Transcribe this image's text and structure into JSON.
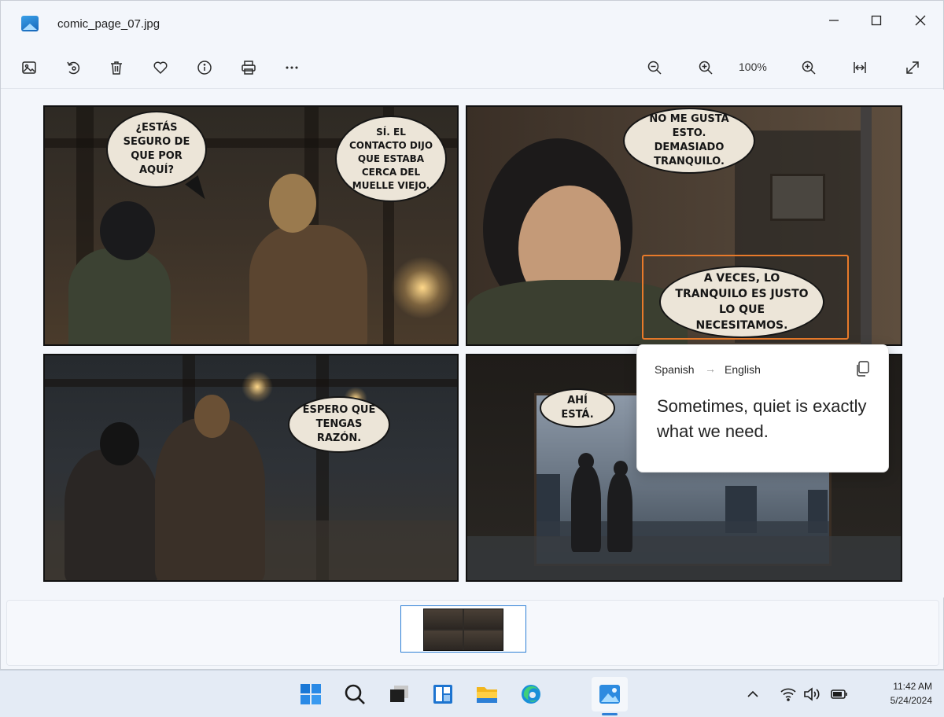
{
  "window": {
    "title": "comic_page_07.jpg"
  },
  "toolbar": {
    "zoom_level": "100%",
    "buttons": [
      "image-icon",
      "rotate-icon",
      "delete-icon",
      "heart-icon",
      "info-icon",
      "print-icon",
      "more-icon"
    ],
    "right_buttons": [
      "zoom-out-icon",
      "zoom-in-icon",
      "zoom-in-icon",
      "fit-width-icon",
      "fullscreen-icon"
    ]
  },
  "comic": {
    "panel1": {
      "bubble_left": "¿ESTÁS SEGURO DE QUE POR AQUÍ?",
      "bubble_right": "SÍ. EL CONTACTO DIJO QUE ESTABA CERCA DEL MUELLE VIEJO."
    },
    "panel2": {
      "bubble_top": "NO ME GUSTA ESTO. DEMASIADO TRANQUILO.",
      "bubble_highlighted": "A VECES, LO TRANQUILO ES JUSTO LO QUE NECESITAMOS."
    },
    "panel3": {
      "bubble": "ESPERO QUE TENGAS RAZÓN."
    },
    "panel4": {
      "bubble": "AHÍ ESTÁ."
    }
  },
  "translation_popup": {
    "source_language": "Spanish",
    "arrow": "→",
    "target_language": "English",
    "translated_text": "Sometimes, quiet is exactly what we need."
  },
  "taskbar": {
    "apps": [
      "start-icon",
      "search-icon",
      "task-view-icon",
      "widgets-icon",
      "file-explorer-icon",
      "edge-icon",
      "photos-icon"
    ],
    "clock_time": "11:42 AM",
    "clock_date": "5/24/2024"
  },
  "colors": {
    "highlight": "#e87a2a",
    "accent": "#2f80d6"
  }
}
